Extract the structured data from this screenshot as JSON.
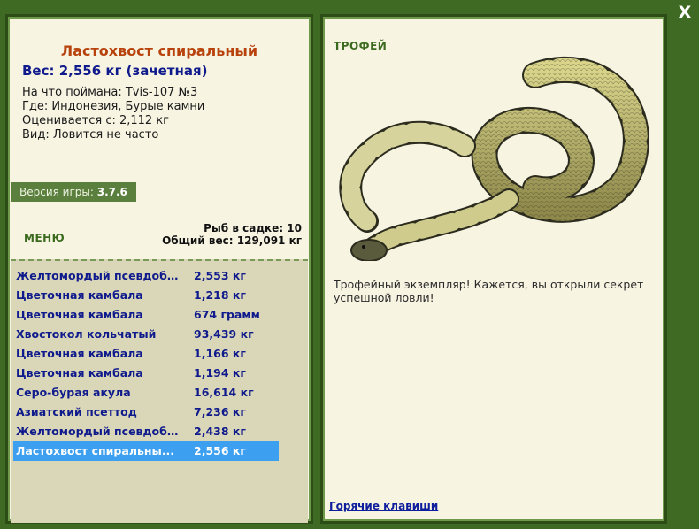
{
  "close_label": "X",
  "left_panel": {
    "fish_name": "Ластохвост спиральный",
    "weight_line": "Вес: 2,556 кг (зачетная)",
    "info": [
      "На что поймана: Tvis-107 №3",
      "Где: Индонезия, Бурые камни",
      "Оценивается с: 2,112 кг",
      "Вид: Ловится не часто"
    ],
    "version_label": "Версия игры:",
    "version_value": "3.7.6",
    "menu_label": "МЕНЮ",
    "fish_count_line": "Рыб в садке: 10",
    "total_weight_line": "Общий вес: 129,091 кг"
  },
  "catch_list": [
    {
      "name": "Желтомордый псевдоба...",
      "weight": "2,553 кг",
      "selected": false
    },
    {
      "name": "Цветочная камбала",
      "weight": "1,218 кг",
      "selected": false
    },
    {
      "name": "Цветочная камбала",
      "weight": "674 грамм",
      "selected": false
    },
    {
      "name": "Хвостокол кольчатый",
      "weight": "93,439 кг",
      "selected": false
    },
    {
      "name": "Цветочная камбала",
      "weight": "1,166 кг",
      "selected": false
    },
    {
      "name": "Цветочная камбала",
      "weight": "1,194 кг",
      "selected": false
    },
    {
      "name": "Серо-бурая акула",
      "weight": "16,614 кг",
      "selected": false
    },
    {
      "name": "Азиатский псеттод",
      "weight": "7,236 кг",
      "selected": false
    },
    {
      "name": "Желтомордый псевдоба...",
      "weight": "2,438 кг",
      "selected": false
    },
    {
      "name": "Ластохвост спиральны...",
      "weight": "2,556 кг",
      "selected": true
    }
  ],
  "right_panel": {
    "trophy_label": "ТРОФЕЙ",
    "trophy_text": "Трофейный экземпляр! Кажется, вы открыли секрет успешной ловли!",
    "hotkeys_link": "Горячие клавиши",
    "image_icon": "sea-snake-image"
  },
  "colors": {
    "background": "#3f6a24",
    "panel": "#f7f4e2",
    "title": "#b8420c",
    "list_text": "#0f1a8c",
    "selection": "#3d9ff0"
  }
}
